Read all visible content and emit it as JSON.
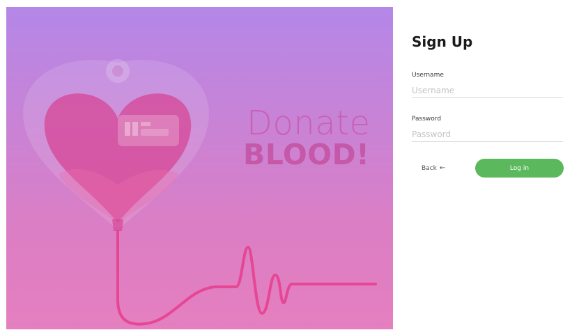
{
  "hero": {
    "headline_line1": "Donate",
    "headline_line2": "BLOOD!"
  },
  "form": {
    "title": "Sign Up",
    "username": {
      "label": "Username",
      "placeholder": "Username",
      "value": ""
    },
    "password": {
      "label": "Password",
      "placeholder": "Password",
      "value": ""
    },
    "back_label": "Back",
    "back_icon": "arrow-left-icon",
    "submit_label": "Log in"
  },
  "colors": {
    "submit_button": "#5cb85c",
    "hero_top": "#b487e8",
    "hero_bottom": "#e57fbf"
  }
}
